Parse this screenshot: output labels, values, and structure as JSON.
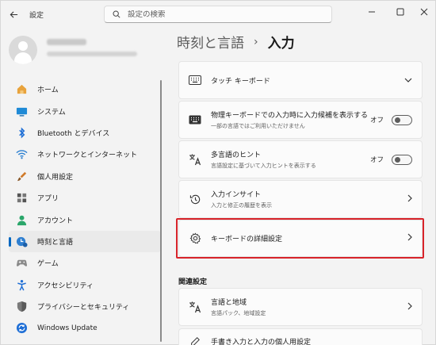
{
  "app": {
    "title": "設定",
    "search_placeholder": "設定の検索"
  },
  "sidebar": {
    "items": [
      {
        "label": "ホーム",
        "icon": "home-icon"
      },
      {
        "label": "システム",
        "icon": "system-icon"
      },
      {
        "label": "Bluetooth とデバイス",
        "icon": "bluetooth-icon"
      },
      {
        "label": "ネットワークとインターネット",
        "icon": "wifi-icon"
      },
      {
        "label": "個人用設定",
        "icon": "brush-icon"
      },
      {
        "label": "アプリ",
        "icon": "apps-icon"
      },
      {
        "label": "アカウント",
        "icon": "account-icon"
      },
      {
        "label": "時刻と言語",
        "icon": "time-language-icon",
        "active": true
      },
      {
        "label": "ゲーム",
        "icon": "gamepad-icon"
      },
      {
        "label": "アクセシビリティ",
        "icon": "accessibility-icon"
      },
      {
        "label": "プライバシーとセキュリティ",
        "icon": "shield-icon"
      },
      {
        "label": "Windows Update",
        "icon": "update-icon"
      }
    ]
  },
  "breadcrumb": {
    "parent": "時刻と言語",
    "separator": "›",
    "current": "入力"
  },
  "cards": {
    "touch_keyboard": {
      "title": "タッチ キーボード"
    },
    "candidates": {
      "title": "物理キーボードでの入力時に入力候補を表示する",
      "subtitle": "一部の言語ではご利用いただけません",
      "toggle_label": "オフ"
    },
    "multilingual": {
      "title": "多言語のヒント",
      "subtitle": "言語設定に基づいて入力ヒントを表示する",
      "toggle_label": "オフ"
    },
    "insights": {
      "title": "入力インサイト",
      "subtitle": "入力と修正の履歴を表示"
    },
    "advanced_keyboard": {
      "title": "キーボードの詳細設定"
    }
  },
  "related": {
    "heading": "関連設定",
    "language_region": {
      "title": "言語と地域",
      "subtitle": "言語パック、地域設定"
    },
    "handwriting": {
      "title": "手書き入力と入力の個人用設定"
    }
  },
  "colors": {
    "accent": "#0067c0",
    "highlight": "#d8232a"
  }
}
